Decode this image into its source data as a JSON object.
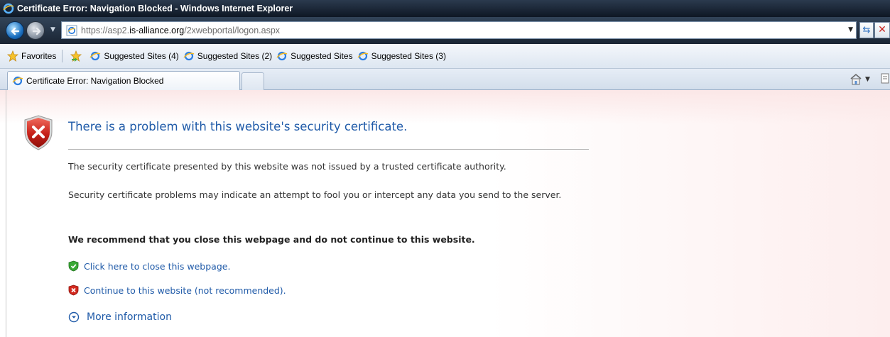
{
  "window": {
    "title": "Certificate Error: Navigation Blocked - Windows Internet Explorer"
  },
  "address": {
    "url_prefix": "https://asp2.",
    "url_domain": "is-alliance.org",
    "url_path": "/2xwebportal/logon.aspx"
  },
  "favorites": {
    "label": "Favorites",
    "items": [
      {
        "label": "Suggested Sites (4)"
      },
      {
        "label": "Suggested Sites (2)"
      },
      {
        "label": "Suggested Sites"
      },
      {
        "label": "Suggested Sites (3)"
      }
    ]
  },
  "tabs": {
    "active_label": "Certificate Error: Navigation Blocked"
  },
  "page": {
    "heading": "There is a problem with this website's security certificate.",
    "paragraph1": "The security certificate presented by this website was not issued by a trusted certificate authority.",
    "paragraph2": "Security certificate problems may indicate an attempt to fool you or intercept any data you send to the server.",
    "recommendation": "We recommend that you close this webpage and do not continue to this website.",
    "close_link": "Click here to close this webpage.",
    "continue_link": "Continue to this website (not recommended).",
    "more_info": "More information"
  },
  "icons": {
    "shield": "error-shield-icon",
    "close_link_icon": "green-check-shield-icon",
    "continue_link_icon": "red-x-shield-icon",
    "more_info_icon": "expand-circle-icon"
  },
  "colors": {
    "link": "#1f5aa8",
    "heading": "#1f5aa8",
    "error_red": "#c8231f",
    "titlebar": "#0e1724"
  }
}
